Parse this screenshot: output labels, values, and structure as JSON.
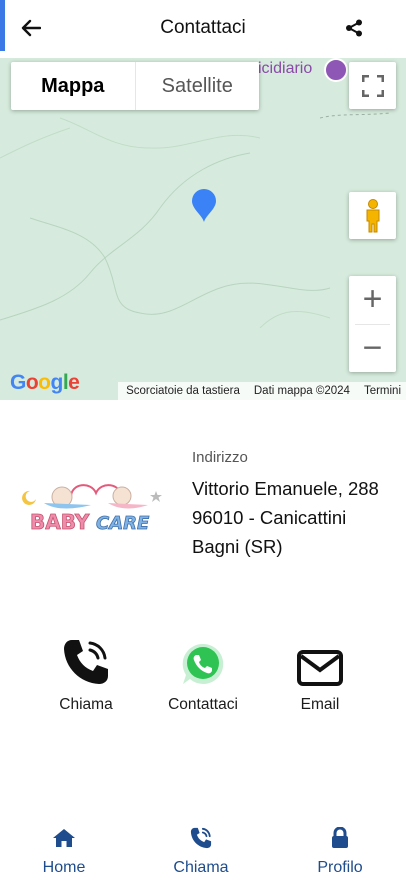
{
  "header": {
    "title": "Contattaci",
    "accent_color": "#3a79e6"
  },
  "map": {
    "type_options": [
      "Mappa",
      "Satellite"
    ],
    "selected_type": "Mappa",
    "poi_label": "icidiario",
    "zoom_in": "+",
    "zoom_out": "−",
    "footer": {
      "shortcuts": "Scorciatoie da tastiera",
      "data": "Dati mappa ©2024",
      "terms": "Termini"
    },
    "google_logo": "Google"
  },
  "address": {
    "label": "Indirizzo",
    "line1": "Vittorio Emanuele, 288",
    "line2": "96010 - Canicattini",
    "line3": "Bagni (SR)",
    "logo_text": "BABYCARE"
  },
  "actions": [
    {
      "label": "Chiama",
      "icon": "phone-call-icon"
    },
    {
      "label": "Contattaci",
      "icon": "whatsapp-icon"
    },
    {
      "label": "Email",
      "icon": "envelope-icon"
    }
  ],
  "bottom_nav": {
    "items": [
      {
        "label": "Home",
        "icon": "home-icon"
      },
      {
        "label": "Chiama",
        "icon": "phone-call-icon"
      },
      {
        "label": "Profilo",
        "icon": "lock-icon"
      }
    ],
    "color": "#1f4c8c"
  }
}
